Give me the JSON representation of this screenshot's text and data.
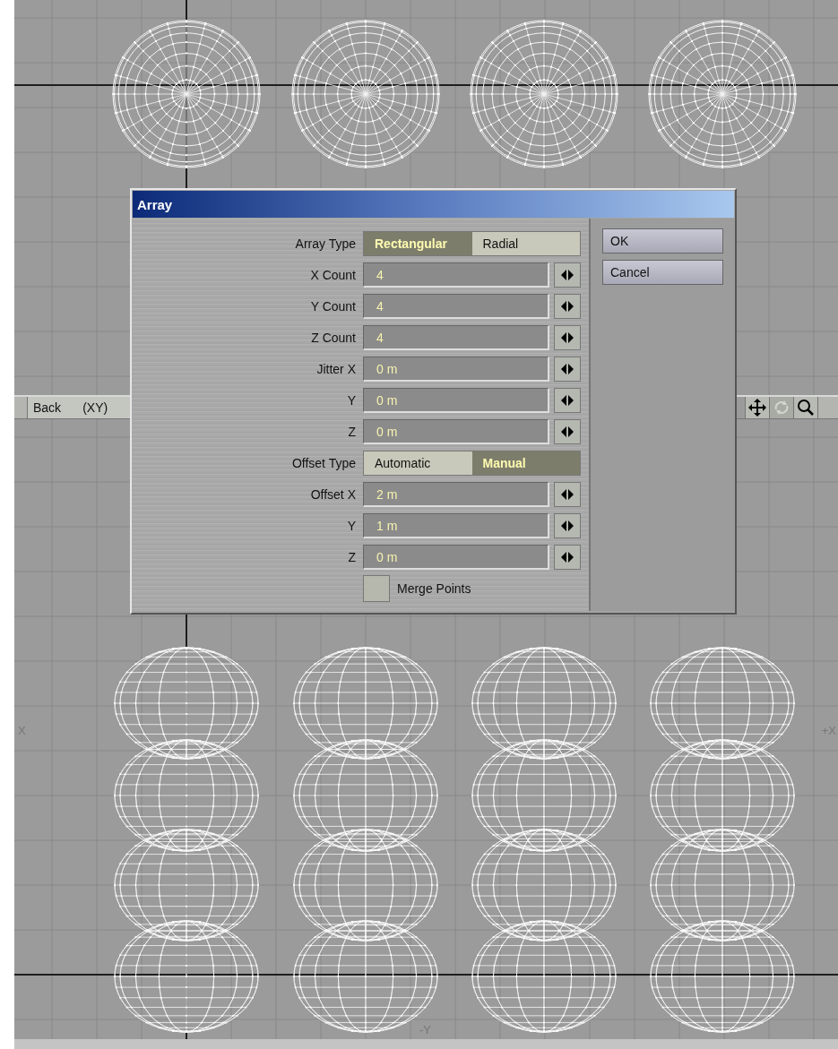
{
  "viewports": [
    {
      "kind": "top"
    },
    {
      "kind": "side",
      "axis_labels": {
        "left": "X",
        "right": "+X",
        "bottom": "-Y"
      }
    }
  ],
  "viewport_bar": {
    "view": "Back",
    "projection": "(XY)",
    "tools": [
      {
        "kind": "move",
        "disabled": false
      },
      {
        "kind": "rotate",
        "disabled": true
      },
      {
        "kind": "zoom",
        "disabled": false
      }
    ]
  },
  "dialog": {
    "title": "Array",
    "rows": [
      {
        "kind": "choice",
        "label": "Array Type",
        "options": [
          {
            "label": "Rectangular",
            "selected": true
          },
          {
            "label": "Radial",
            "selected": false
          }
        ]
      },
      {
        "kind": "number",
        "label": "X Count",
        "value": "4"
      },
      {
        "kind": "number",
        "label": "Y Count",
        "value": "4"
      },
      {
        "kind": "number",
        "label": "Z Count",
        "value": "4"
      },
      {
        "kind": "number",
        "label": "Jitter X",
        "value": "0 m"
      },
      {
        "kind": "number",
        "label": "Y",
        "value": "0 m"
      },
      {
        "kind": "number",
        "label": "Z",
        "value": "0 m"
      },
      {
        "kind": "choice",
        "label": "Offset Type",
        "options": [
          {
            "label": "Automatic",
            "selected": false
          },
          {
            "label": "Manual",
            "selected": true
          }
        ]
      },
      {
        "kind": "number",
        "label": "Offset X",
        "value": "2 m"
      },
      {
        "kind": "number",
        "label": "Y",
        "value": "1 m"
      },
      {
        "kind": "number",
        "label": "Z",
        "value": "0 m"
      },
      {
        "kind": "checkbox",
        "label": "Merge Points",
        "checked": false
      }
    ],
    "buttons": [
      "OK",
      "Cancel"
    ]
  }
}
